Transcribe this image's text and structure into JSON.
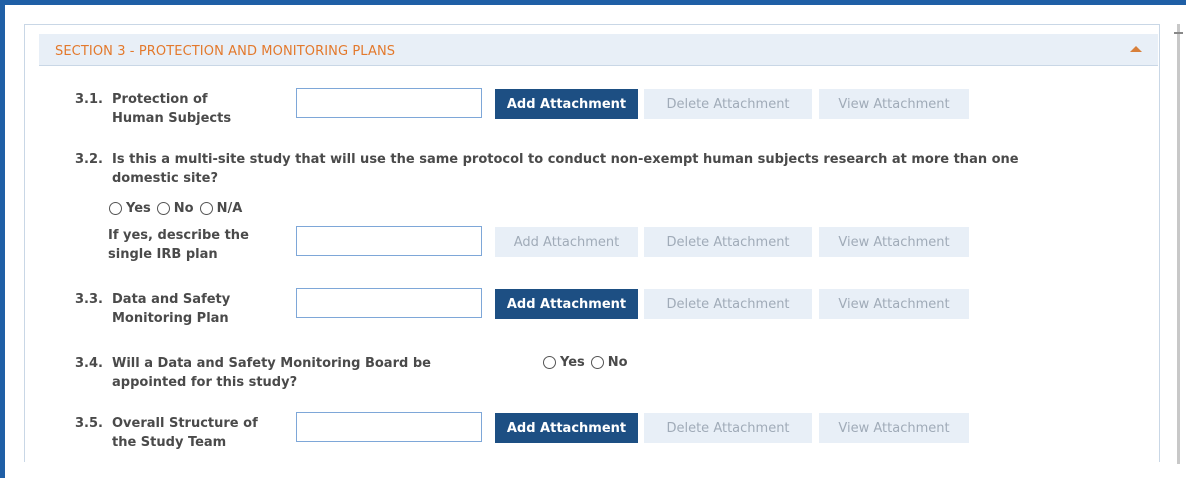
{
  "section": {
    "title": "SECTION 3 - PROTECTION AND MONITORING PLANS",
    "accent_color": "#e3792c",
    "header_bg": "#e8eff7"
  },
  "buttons": {
    "add": "Add Attachment",
    "delete": "Delete Attachment",
    "view": "View Attachment",
    "primary_color": "#1d4f83",
    "disabled_color": "#e8eff7"
  },
  "items": [
    {
      "number": "3.1.",
      "label_line1": "Protection of",
      "label_line2": "Human Subjects",
      "attachment_value": "",
      "add_enabled": true
    },
    {
      "number": "3.2.",
      "question_line1": "Is this a multi-site study that will use the same protocol to conduct non-exempt human subjects research at more than one",
      "question_line2": "domestic site?",
      "options": [
        "Yes",
        "No",
        "N/A"
      ],
      "followup_line1": "If yes, describe the",
      "followup_line2": "single IRB plan",
      "attachment_value": "",
      "add_enabled": false
    },
    {
      "number": "3.3.",
      "label_line1": "Data and Safety",
      "label_line2": "Monitoring Plan",
      "attachment_value": "",
      "add_enabled": true
    },
    {
      "number": "3.4.",
      "question_line1": "Will a Data and Safety Monitoring Board be",
      "question_line2": "appointed for this study?",
      "options": [
        "Yes",
        "No"
      ]
    },
    {
      "number": "3.5.",
      "label_line1": "Overall Structure of",
      "label_line2": "the Study Team",
      "attachment_value": "",
      "add_enabled": true
    }
  ]
}
